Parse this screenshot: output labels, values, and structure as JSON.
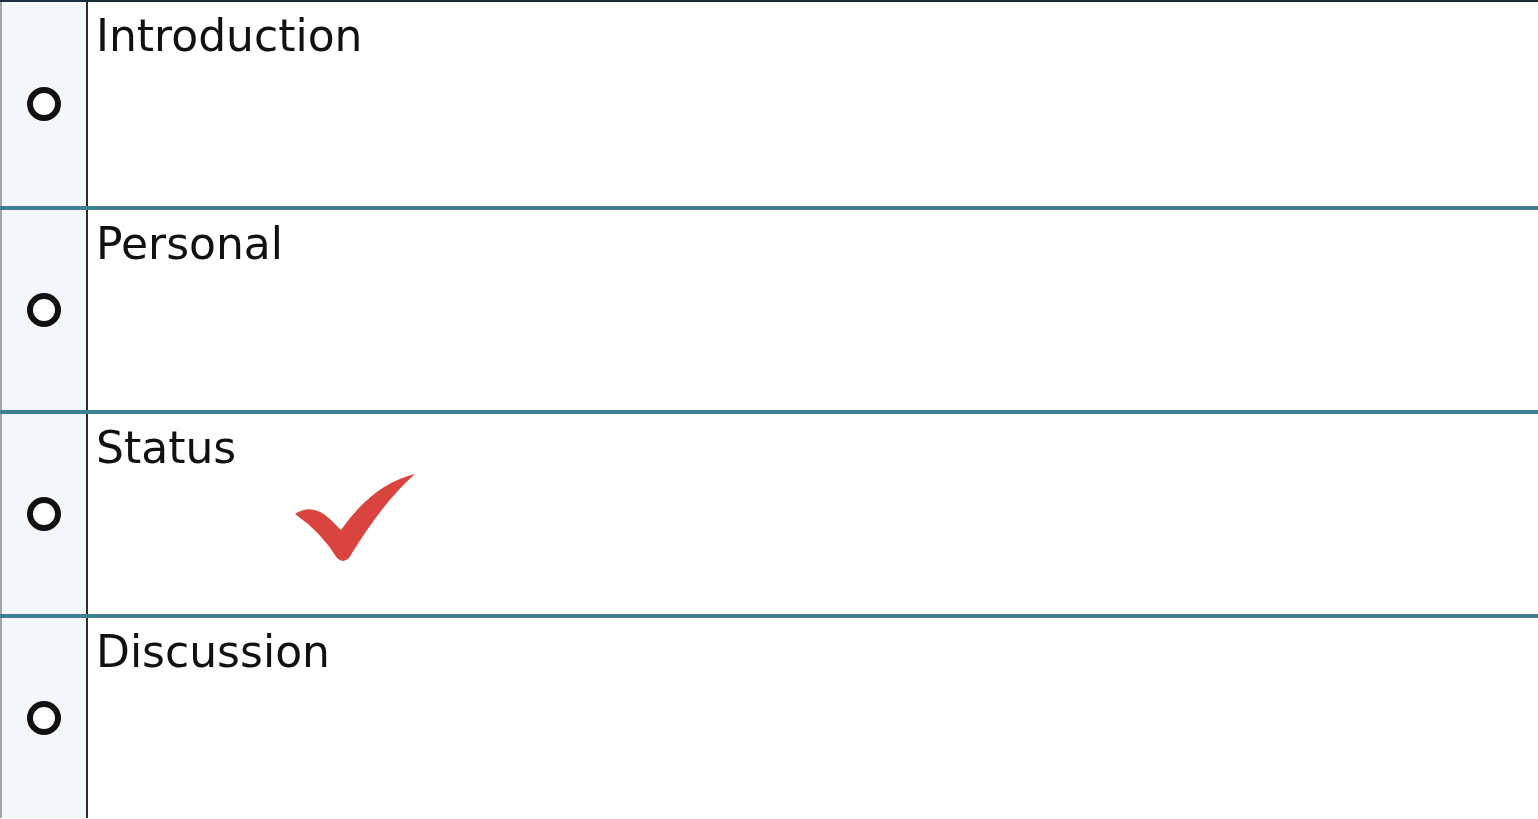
{
  "options": [
    {
      "label": "Introduction",
      "selected": false,
      "marked_correct": false
    },
    {
      "label": "Personal",
      "selected": false,
      "marked_correct": false
    },
    {
      "label": "Status",
      "selected": false,
      "marked_correct": true
    },
    {
      "label": "Discussion",
      "selected": false,
      "marked_correct": false
    }
  ]
}
